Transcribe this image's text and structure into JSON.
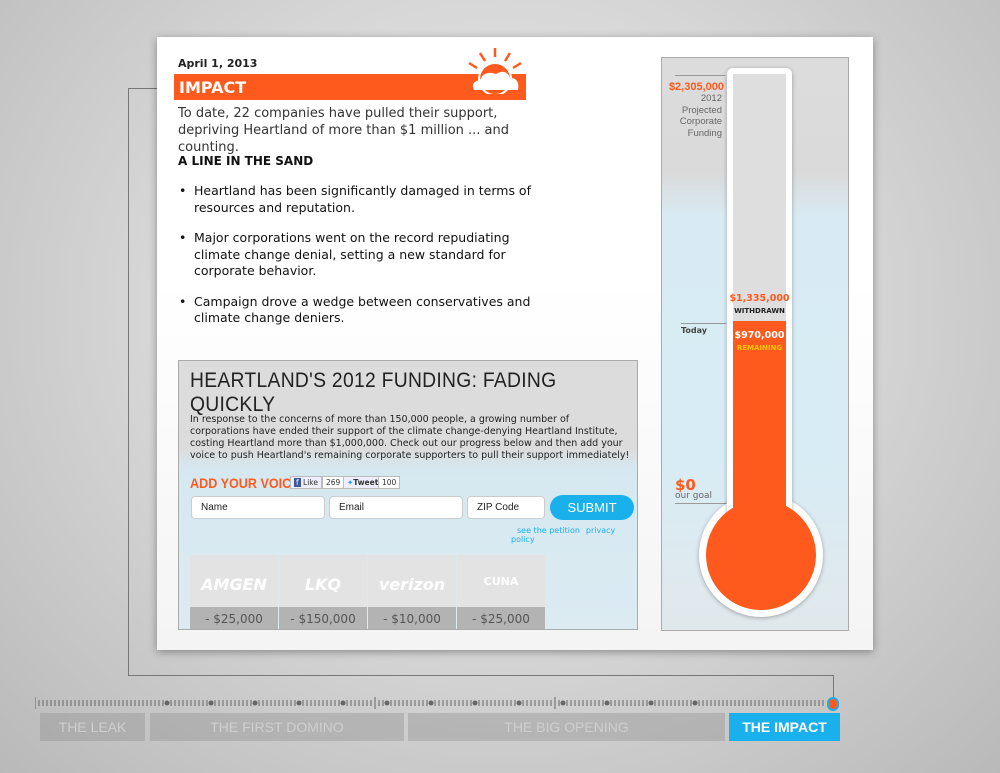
{
  "date": "April 1, 2013",
  "section_title": "IMPACT",
  "intro": "To date, 22 companies have pulled their support, depriving Heartland of more than $1 million ... and counting.",
  "subheading": "A LINE IN THE SAND",
  "bullets": [
    "Heartland has been significantly damaged in terms of resources and reputation.",
    "Major corporations went on the record repudiating climate change denial, setting a new standard for corporate behavior.",
    "Campaign drove a wedge between conservatives and climate change deniers."
  ],
  "funding": {
    "title": "HEARTLAND'S 2012 FUNDING: FADING QUICKLY",
    "paragraph": "In response to the concerns of more than 150,000 people, a growing number of corporations have ended their support of the climate change-denying Heartland Institute, costing Heartland more than $1,000,000. Check out our progress below and then add your voice to push Heartland's remaining corporate supporters to pull their support immediately!",
    "add_voice": "ADD YOUR VOICE",
    "fb_like": "Like",
    "fb_count": "269",
    "tweet": "Tweet",
    "tweet_count": "100",
    "name_placeholder": "Name",
    "email_placeholder": "Email",
    "zip_placeholder": "ZIP Code",
    "submit": "SUBMIT",
    "petition_link": "see the petition",
    "privacy_link": "privacy policy",
    "companies": [
      {
        "name": "AMGEN",
        "amount": "- $25,000"
      },
      {
        "name": "LKQ",
        "amount": "- $150,000"
      },
      {
        "name": "verizon",
        "amount": "- $10,000"
      },
      {
        "name": "CUNA",
        "amount": "- $25,000"
      }
    ]
  },
  "thermometer": {
    "projected_amount": "$2,305,000",
    "projected_label": [
      "2012",
      "Projected",
      "Corporate",
      "Funding"
    ],
    "withdrawn_amount": "$1,335,000",
    "withdrawn_label": "WITHDRAWN",
    "remaining_amount": "$970,000",
    "remaining_label": "REMAINING",
    "today_label": "Today",
    "goal_amount": "$0",
    "goal_label": "our goal",
    "remaining_fraction": 0.42,
    "colors": {
      "fill": "#fe5a1d",
      "accent": "#1ab0ec"
    }
  },
  "timeline": {
    "segments": [
      "THE LEAK",
      "THE FIRST DOMINO",
      "THE BIG OPENING",
      "THE IMPACT"
    ],
    "active": "THE IMPACT"
  }
}
